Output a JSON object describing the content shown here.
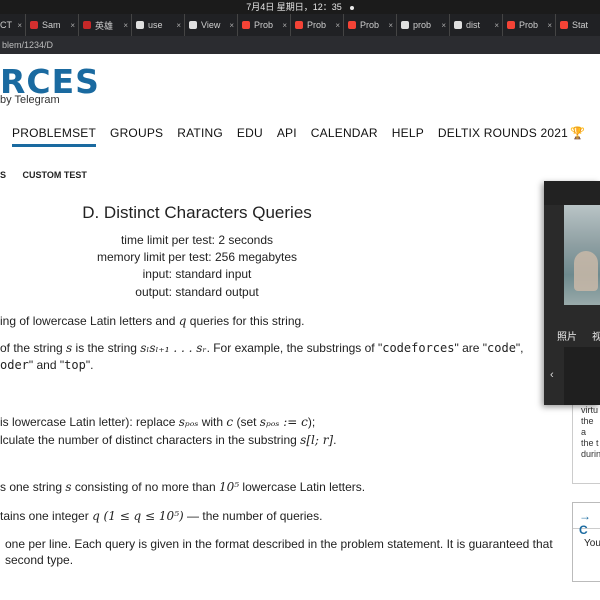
{
  "system": {
    "clock": "7月4日 星期日，12：35"
  },
  "tabs": [
    {
      "label": "CT",
      "color": "#9e9e9e"
    },
    {
      "label": "Sam",
      "color": "#d32f2f"
    },
    {
      "label": "英雄",
      "color": "#c62828"
    },
    {
      "label": "use",
      "color": "#e0e0e0"
    },
    {
      "label": "View",
      "color": "#e0e0e0"
    },
    {
      "label": "Prob",
      "color": "#f44336"
    },
    {
      "label": "Prob",
      "color": "#f44336"
    },
    {
      "label": "Prob",
      "color": "#f44336"
    },
    {
      "label": "prob",
      "color": "#e0e0e0"
    },
    {
      "label": "dist",
      "color": "#e0e0e0"
    },
    {
      "label": "Prob",
      "color": "#f44336"
    },
    {
      "label": "Stat",
      "color": "#f44336"
    }
  ],
  "address": {
    "url": "blem/1234/D"
  },
  "header": {
    "logo": "RCES",
    "tagline": "by Telegram"
  },
  "nav": {
    "items": [
      "PROBLEMSET",
      "GROUPS",
      "RATING",
      "EDU",
      "API",
      "CALENDAR",
      "HELP",
      "DELTIX ROUNDS 2021"
    ],
    "trophy": "🏆"
  },
  "subnav": {
    "left": "S",
    "custom_test": "CUSTOM TEST"
  },
  "problem": {
    "title": "D. Distinct Characters Queries",
    "time_limit": "time limit per test: 2 seconds",
    "memory_limit": "memory limit per test: 256 megabytes",
    "input": "input: standard input",
    "output": "output: standard output",
    "p1": {
      "pre": "ing of lowercase Latin letters and ",
      "q": "q",
      "post": " queries for this string."
    },
    "p2": {
      "pre": "of the string ",
      "s": "s",
      "mid": " is the string ",
      "sub": "sₗsₗ₊₁ . . . sᵣ",
      "post": ". For example, the substrings of \"",
      "code1": "codeforces",
      "post2": "\" are \"",
      "code2": "code",
      "post3": "\","
    },
    "p2b": {
      "code3": "oder",
      "mid": "\" and \"",
      "code4": "top",
      "post": "\"."
    },
    "p3": {
      "pre": "is lowercase Latin letter): replace ",
      "spos": "sₚₒₛ",
      "mid": " with ",
      "c": "c",
      "paren": " (set ",
      "assign": "sₚₒₛ := c",
      "post": ");"
    },
    "p4": {
      "pre": "lculate the number of distinct characters in the substring ",
      "range": "s[l; r]",
      "post": "."
    },
    "p5": {
      "pre": "s one string ",
      "s": "s",
      "mid": " consisting of no more than ",
      "limit": "10⁵",
      "post": " lowercase Latin letters."
    },
    "p6": {
      "pre": "tains one integer ",
      "expr": "q (1 ≤ q ≤ 10⁵)",
      "post": " — the number of queries."
    },
    "p7": "one per line. Each query is given in the format described in the problem statement. It is guaranteed that",
    "p8": "second type."
  },
  "right_panel": {
    "box1_lines": [
      "virtu",
      "the a",
      "the t",
      "durin"
    ],
    "box2_header": "→ C",
    "box2_text": "You"
  },
  "video": {
    "label_photo": "照片",
    "label_other": "视",
    "chevron": "‹"
  }
}
